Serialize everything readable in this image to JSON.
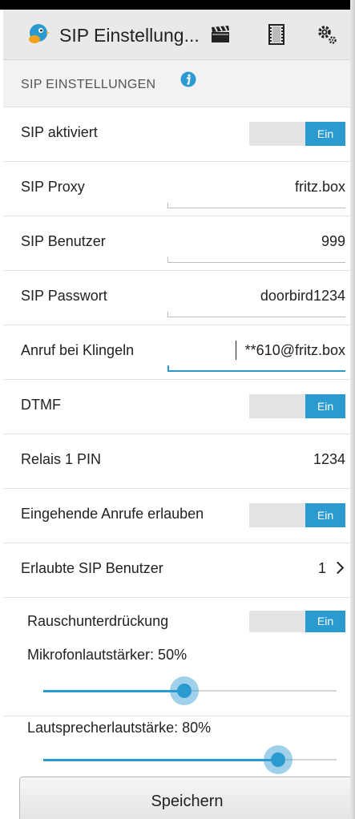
{
  "appbar": {
    "title": "SIP Einstellung...",
    "icons": [
      "doorbird-logo-icon",
      "clapperboard-icon",
      "film-strip-icon",
      "settings-gears-icon"
    ]
  },
  "section": {
    "title": "SIP EINSTELLUNGEN",
    "icon": "info-icon"
  },
  "rows": {
    "sip_active": {
      "label": "SIP aktiviert",
      "toggle": "Ein"
    },
    "sip_proxy": {
      "label": "SIP Proxy",
      "value": "fritz.box"
    },
    "sip_user": {
      "label": "SIP Benutzer",
      "value": "999"
    },
    "sip_password": {
      "label": "SIP Passwort",
      "value": "doorbird1234"
    },
    "ring_call": {
      "label": "Anruf bei Klingeln",
      "value": "**610@fritz.box"
    },
    "dtmf": {
      "label": "DTMF",
      "toggle": "Ein"
    },
    "relay_pin": {
      "label": "Relais 1 PIN",
      "value": "1234"
    },
    "incoming": {
      "label": "Eingehende Anrufe erlauben",
      "toggle": "Ein"
    },
    "allowed_users": {
      "label": "Erlaubte SIP Benutzer",
      "value": "1"
    },
    "noise": {
      "label": "Rauschunterdrückung",
      "toggle": "Ein"
    }
  },
  "sliders": {
    "mic": {
      "label": "Mikrofonlautstärker: 50%",
      "level": 0.5
    },
    "speaker": {
      "label": "Lautsprecherlautstärke: 80%",
      "level": 0.8
    }
  },
  "save_label": "Speichern",
  "colors": {
    "accent": "#2b9ad0",
    "appbar": "#e9e9e9",
    "section": "#f2f2f2"
  }
}
